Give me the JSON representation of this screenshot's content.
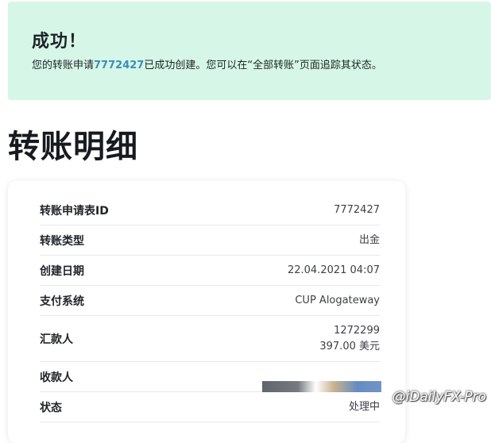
{
  "alert": {
    "title": "成功！",
    "text_before": "您的转账申请",
    "request_id": "7772427",
    "text_after": "已成功创建。您可以在“全部转账”页面追踪其状态。"
  },
  "page_title": "转账明细",
  "details": [
    {
      "label": "转账申请表ID",
      "value": "7772427"
    },
    {
      "label": "转账类型",
      "value": "出金"
    },
    {
      "label": "创建日期",
      "value": "22.04.2021 04:07"
    },
    {
      "label": "支付系统",
      "value": "CUP Alogateway"
    },
    {
      "label": "汇款人",
      "value": "1272299",
      "value2": "397.00 美元"
    },
    {
      "label": "收款人",
      "value": ""
    },
    {
      "label": "状态",
      "value": "处理中"
    }
  ],
  "watermark": "@iDailyFX-Pro",
  "colors": {
    "alert_bg": "#d6f7e7",
    "link": "#3b8dbd"
  }
}
